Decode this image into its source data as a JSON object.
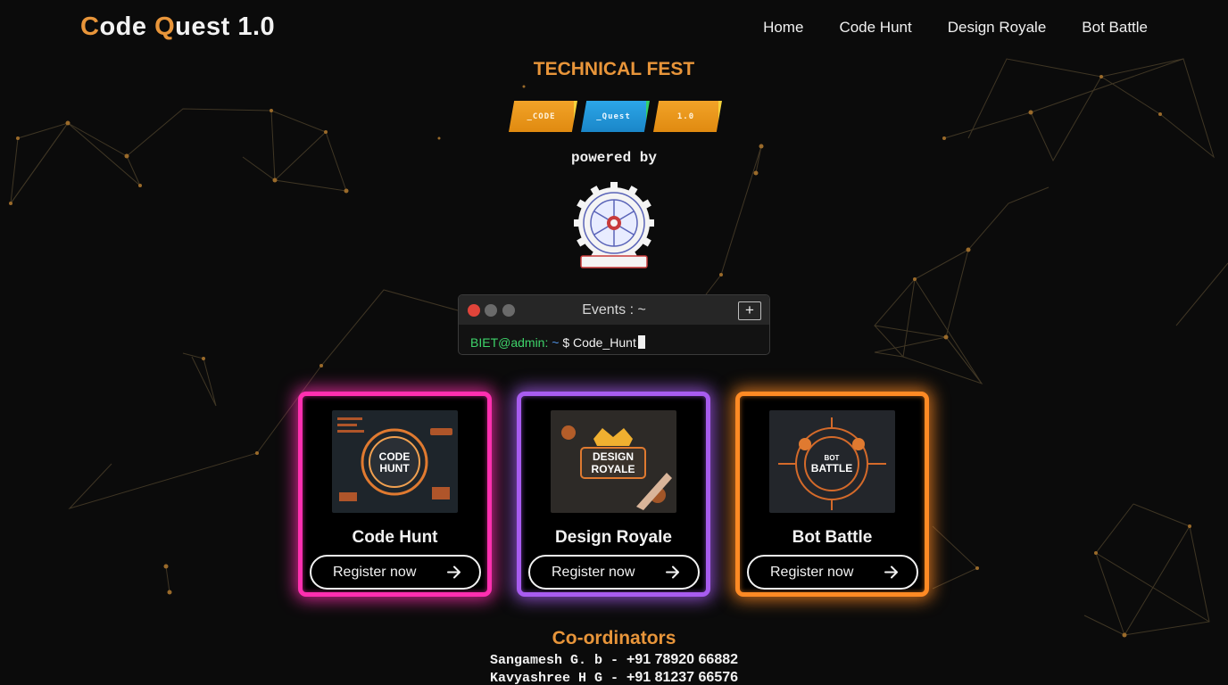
{
  "brand": {
    "c": "C",
    "ode": "ode ",
    "q": "Q",
    "uest": "uest 1.0"
  },
  "nav": {
    "home": "Home",
    "code_hunt": "Code Hunt",
    "design_royale": "Design Royale",
    "bot_battle": "Bot Battle"
  },
  "fest_title": "TECHNICAL FEST",
  "badges": [
    "_CODE",
    "_Quest",
    "1.0"
  ],
  "powered_by": "powered by",
  "terminal": {
    "title": "Events : ~",
    "plus": "+",
    "user": "BIET@admin:",
    "tilde": "~",
    "command": "$ Code_Hunt"
  },
  "cards": [
    {
      "title": "Code Hunt",
      "button": "Register now",
      "image_text": [
        "CODE",
        "HUNT"
      ],
      "color": "#ff2fb0"
    },
    {
      "title": "Design Royale",
      "button": "Register now",
      "image_text": [
        "DESIGN",
        "ROYALE"
      ],
      "color": "#a85cf0"
    },
    {
      "title": "Bot Battle",
      "button": "Register now",
      "image_text": [
        "BOT",
        "BATTLE"
      ],
      "color": "#ff8a24"
    }
  ],
  "coordinators": {
    "title": "Co-ordinators",
    "people": [
      {
        "name": "Sangamesh G. b - ",
        "phone": "+91 78920 66882"
      },
      {
        "name": "Kavyashree H G - ",
        "phone": "+91 81237 66576"
      }
    ]
  },
  "colors": {
    "accent": "#e8953a",
    "prompt_green": "#3ed46a"
  },
  "icons": {
    "close": "close-dot-icon",
    "arrow": "arrow-right-icon",
    "add": "plus-icon"
  }
}
